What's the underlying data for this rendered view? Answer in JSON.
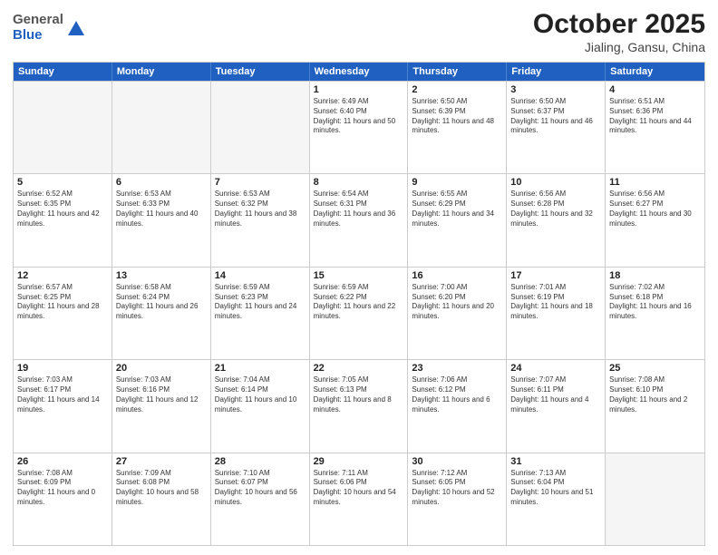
{
  "header": {
    "logo": {
      "general": "General",
      "blue": "Blue"
    },
    "title": "October 2025",
    "subtitle": "Jialing, Gansu, China"
  },
  "weekdays": [
    "Sunday",
    "Monday",
    "Tuesday",
    "Wednesday",
    "Thursday",
    "Friday",
    "Saturday"
  ],
  "rows": [
    [
      {
        "day": "",
        "empty": true
      },
      {
        "day": "",
        "empty": true
      },
      {
        "day": "",
        "empty": true
      },
      {
        "day": "1",
        "sunrise": "Sunrise: 6:49 AM",
        "sunset": "Sunset: 6:40 PM",
        "daylight": "Daylight: 11 hours and 50 minutes."
      },
      {
        "day": "2",
        "sunrise": "Sunrise: 6:50 AM",
        "sunset": "Sunset: 6:39 PM",
        "daylight": "Daylight: 11 hours and 48 minutes."
      },
      {
        "day": "3",
        "sunrise": "Sunrise: 6:50 AM",
        "sunset": "Sunset: 6:37 PM",
        "daylight": "Daylight: 11 hours and 46 minutes."
      },
      {
        "day": "4",
        "sunrise": "Sunrise: 6:51 AM",
        "sunset": "Sunset: 6:36 PM",
        "daylight": "Daylight: 11 hours and 44 minutes."
      }
    ],
    [
      {
        "day": "5",
        "sunrise": "Sunrise: 6:52 AM",
        "sunset": "Sunset: 6:35 PM",
        "daylight": "Daylight: 11 hours and 42 minutes."
      },
      {
        "day": "6",
        "sunrise": "Sunrise: 6:53 AM",
        "sunset": "Sunset: 6:33 PM",
        "daylight": "Daylight: 11 hours and 40 minutes."
      },
      {
        "day": "7",
        "sunrise": "Sunrise: 6:53 AM",
        "sunset": "Sunset: 6:32 PM",
        "daylight": "Daylight: 11 hours and 38 minutes."
      },
      {
        "day": "8",
        "sunrise": "Sunrise: 6:54 AM",
        "sunset": "Sunset: 6:31 PM",
        "daylight": "Daylight: 11 hours and 36 minutes."
      },
      {
        "day": "9",
        "sunrise": "Sunrise: 6:55 AM",
        "sunset": "Sunset: 6:29 PM",
        "daylight": "Daylight: 11 hours and 34 minutes."
      },
      {
        "day": "10",
        "sunrise": "Sunrise: 6:56 AM",
        "sunset": "Sunset: 6:28 PM",
        "daylight": "Daylight: 11 hours and 32 minutes."
      },
      {
        "day": "11",
        "sunrise": "Sunrise: 6:56 AM",
        "sunset": "Sunset: 6:27 PM",
        "daylight": "Daylight: 11 hours and 30 minutes."
      }
    ],
    [
      {
        "day": "12",
        "sunrise": "Sunrise: 6:57 AM",
        "sunset": "Sunset: 6:25 PM",
        "daylight": "Daylight: 11 hours and 28 minutes."
      },
      {
        "day": "13",
        "sunrise": "Sunrise: 6:58 AM",
        "sunset": "Sunset: 6:24 PM",
        "daylight": "Daylight: 11 hours and 26 minutes."
      },
      {
        "day": "14",
        "sunrise": "Sunrise: 6:59 AM",
        "sunset": "Sunset: 6:23 PM",
        "daylight": "Daylight: 11 hours and 24 minutes."
      },
      {
        "day": "15",
        "sunrise": "Sunrise: 6:59 AM",
        "sunset": "Sunset: 6:22 PM",
        "daylight": "Daylight: 11 hours and 22 minutes."
      },
      {
        "day": "16",
        "sunrise": "Sunrise: 7:00 AM",
        "sunset": "Sunset: 6:20 PM",
        "daylight": "Daylight: 11 hours and 20 minutes."
      },
      {
        "day": "17",
        "sunrise": "Sunrise: 7:01 AM",
        "sunset": "Sunset: 6:19 PM",
        "daylight": "Daylight: 11 hours and 18 minutes."
      },
      {
        "day": "18",
        "sunrise": "Sunrise: 7:02 AM",
        "sunset": "Sunset: 6:18 PM",
        "daylight": "Daylight: 11 hours and 16 minutes."
      }
    ],
    [
      {
        "day": "19",
        "sunrise": "Sunrise: 7:03 AM",
        "sunset": "Sunset: 6:17 PM",
        "daylight": "Daylight: 11 hours and 14 minutes."
      },
      {
        "day": "20",
        "sunrise": "Sunrise: 7:03 AM",
        "sunset": "Sunset: 6:16 PM",
        "daylight": "Daylight: 11 hours and 12 minutes."
      },
      {
        "day": "21",
        "sunrise": "Sunrise: 7:04 AM",
        "sunset": "Sunset: 6:14 PM",
        "daylight": "Daylight: 11 hours and 10 minutes."
      },
      {
        "day": "22",
        "sunrise": "Sunrise: 7:05 AM",
        "sunset": "Sunset: 6:13 PM",
        "daylight": "Daylight: 11 hours and 8 minutes."
      },
      {
        "day": "23",
        "sunrise": "Sunrise: 7:06 AM",
        "sunset": "Sunset: 6:12 PM",
        "daylight": "Daylight: 11 hours and 6 minutes."
      },
      {
        "day": "24",
        "sunrise": "Sunrise: 7:07 AM",
        "sunset": "Sunset: 6:11 PM",
        "daylight": "Daylight: 11 hours and 4 minutes."
      },
      {
        "day": "25",
        "sunrise": "Sunrise: 7:08 AM",
        "sunset": "Sunset: 6:10 PM",
        "daylight": "Daylight: 11 hours and 2 minutes."
      }
    ],
    [
      {
        "day": "26",
        "sunrise": "Sunrise: 7:08 AM",
        "sunset": "Sunset: 6:09 PM",
        "daylight": "Daylight: 11 hours and 0 minutes."
      },
      {
        "day": "27",
        "sunrise": "Sunrise: 7:09 AM",
        "sunset": "Sunset: 6:08 PM",
        "daylight": "Daylight: 10 hours and 58 minutes."
      },
      {
        "day": "28",
        "sunrise": "Sunrise: 7:10 AM",
        "sunset": "Sunset: 6:07 PM",
        "daylight": "Daylight: 10 hours and 56 minutes."
      },
      {
        "day": "29",
        "sunrise": "Sunrise: 7:11 AM",
        "sunset": "Sunset: 6:06 PM",
        "daylight": "Daylight: 10 hours and 54 minutes."
      },
      {
        "day": "30",
        "sunrise": "Sunrise: 7:12 AM",
        "sunset": "Sunset: 6:05 PM",
        "daylight": "Daylight: 10 hours and 52 minutes."
      },
      {
        "day": "31",
        "sunrise": "Sunrise: 7:13 AM",
        "sunset": "Sunset: 6:04 PM",
        "daylight": "Daylight: 10 hours and 51 minutes."
      },
      {
        "day": "",
        "empty": true
      }
    ]
  ]
}
